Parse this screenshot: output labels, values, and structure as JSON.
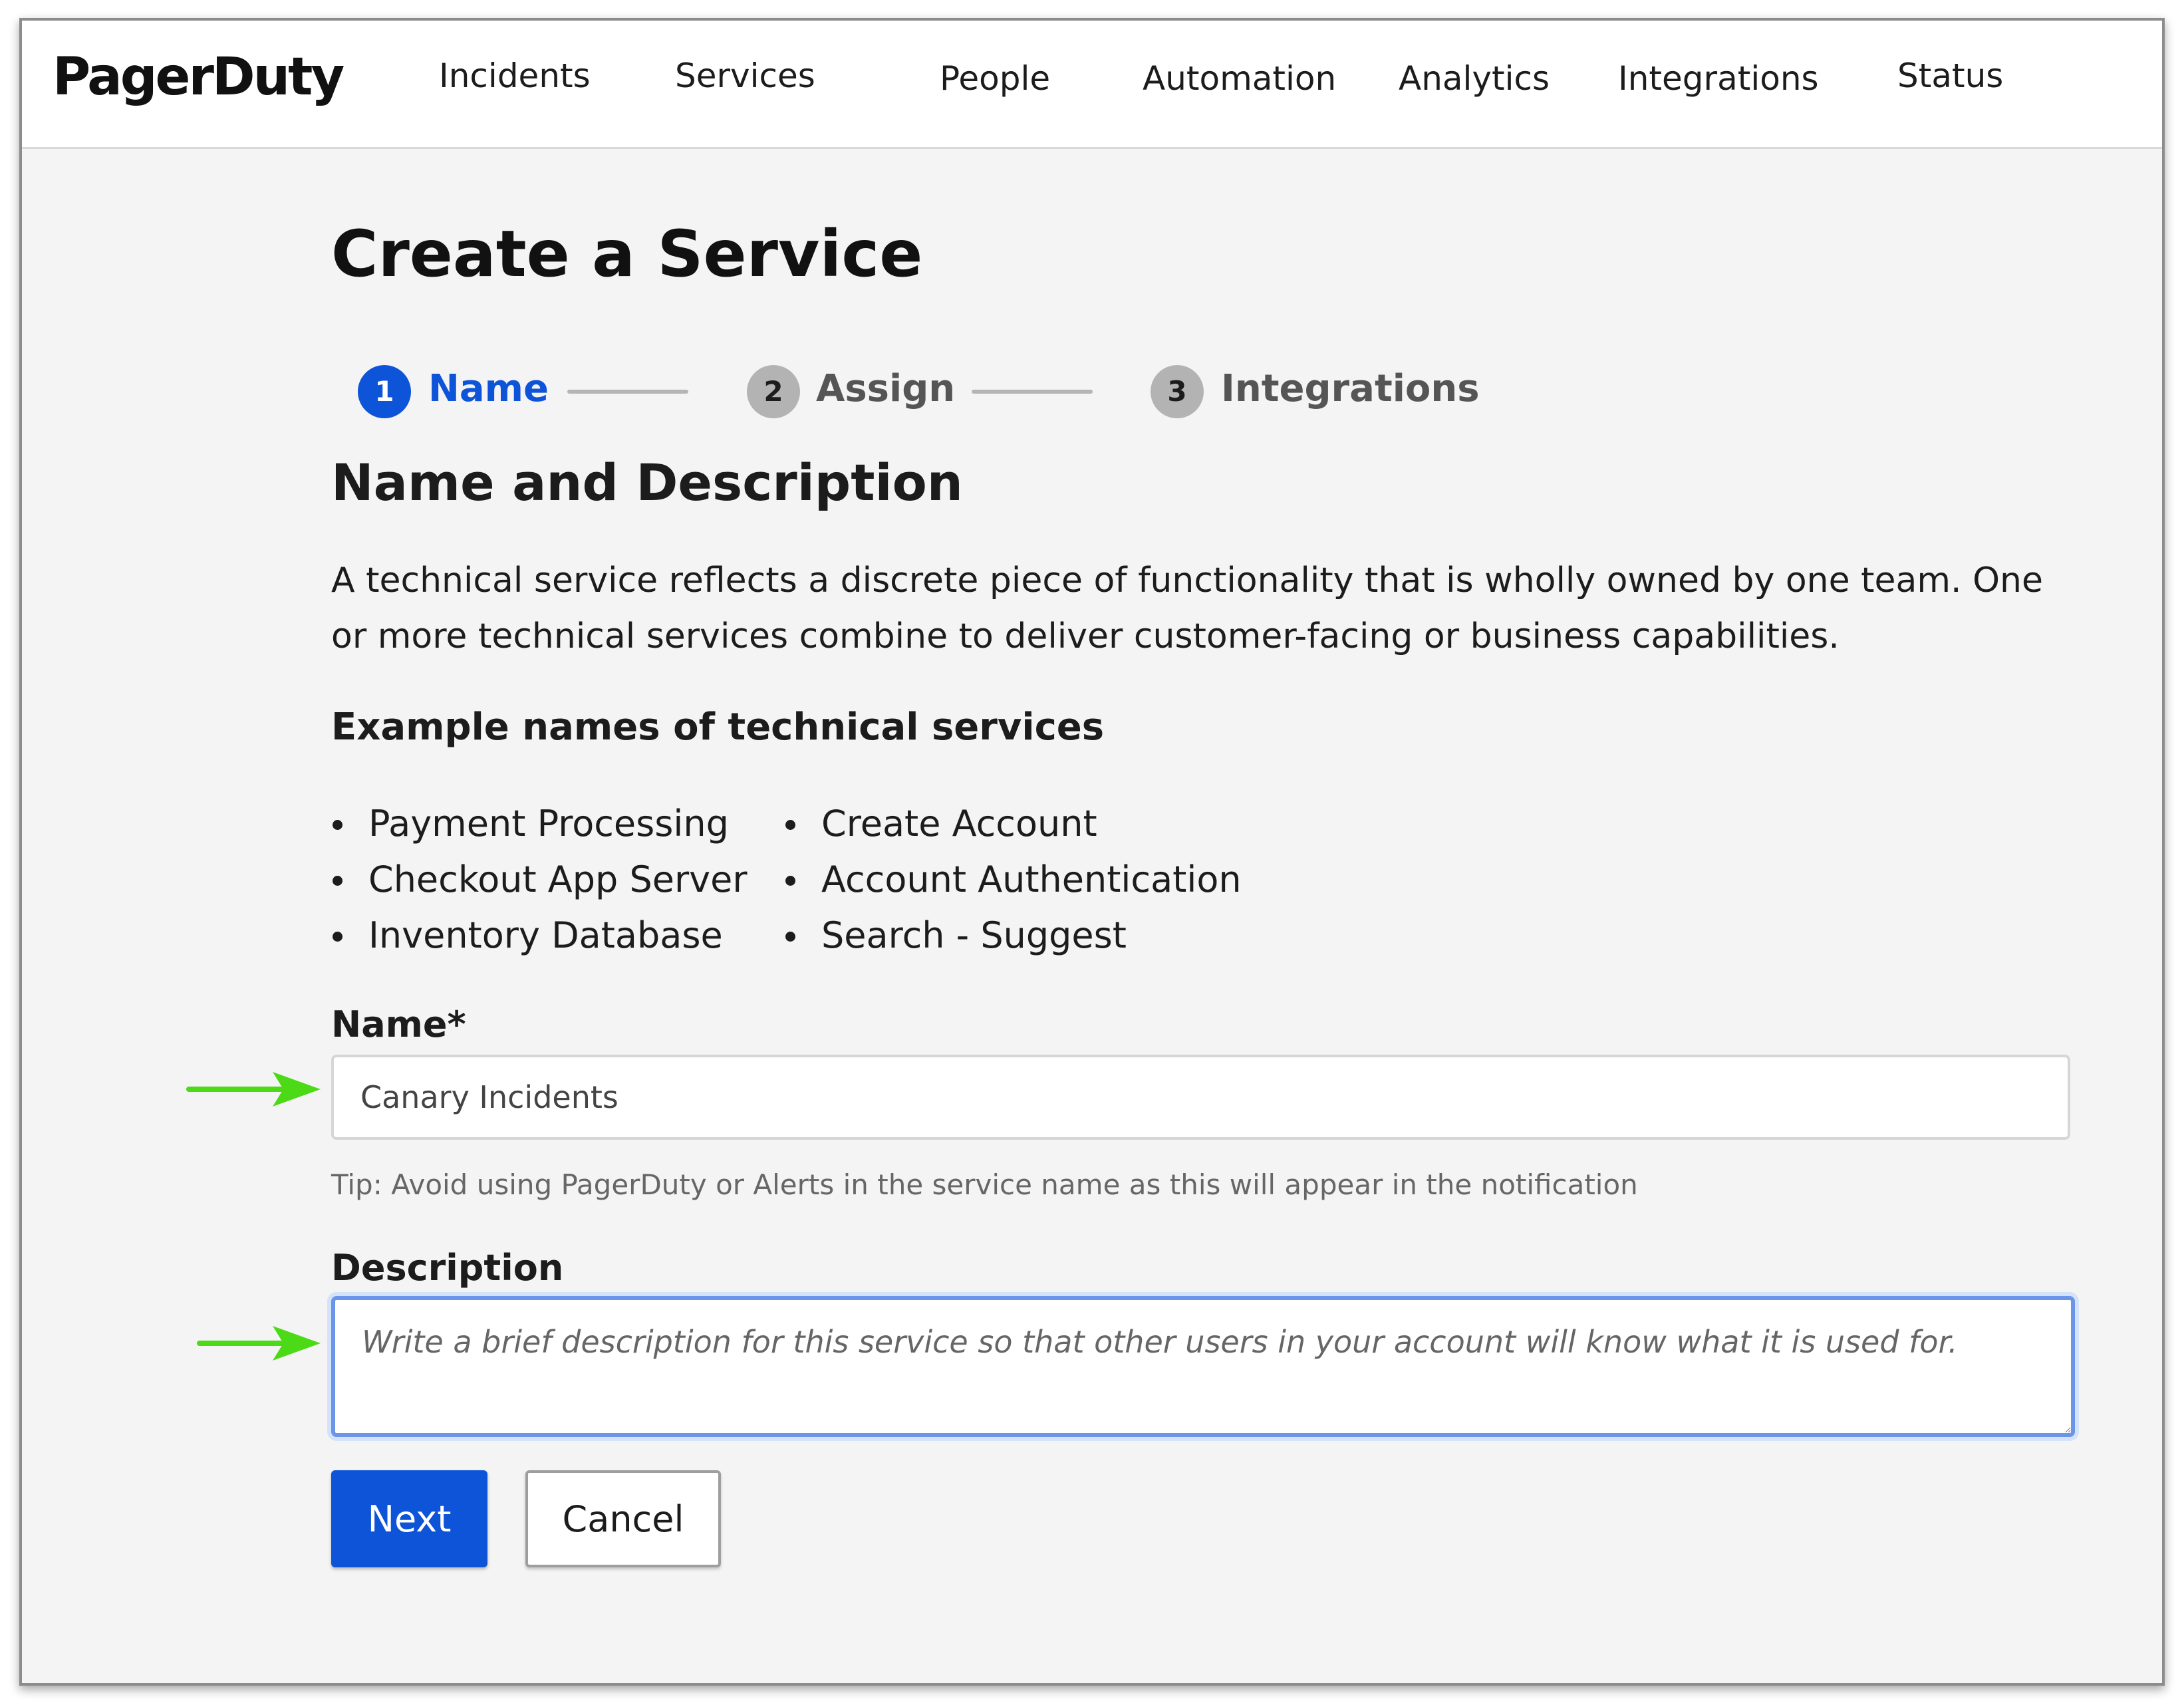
{
  "brand": {
    "logo_text": "PagerDuty"
  },
  "nav": {
    "items": [
      {
        "label": "Incidents"
      },
      {
        "label": "Services"
      },
      {
        "label": "People"
      },
      {
        "label": "Automation"
      },
      {
        "label": "Analytics"
      },
      {
        "label": "Integrations"
      },
      {
        "label": "Status"
      }
    ]
  },
  "page": {
    "title": "Create a Service"
  },
  "stepper": {
    "steps": [
      {
        "number": "1",
        "label": "Name",
        "state": "active"
      },
      {
        "number": "2",
        "label": "Assign",
        "state": "inactive"
      },
      {
        "number": "3",
        "label": "Integrations",
        "state": "inactive"
      }
    ]
  },
  "section": {
    "title": "Name and Description",
    "description": "A technical service reflects a discrete piece of functionality that is wholly owned by one team. One or more technical services combine to deliver customer-facing or business capabilities.",
    "examples_title": "Example names of technical services",
    "examples_col1": [
      "Payment Processing",
      "Checkout App Server",
      "Inventory Database"
    ],
    "examples_col2": [
      "Create Account",
      "Account Authentication",
      "Search - Suggest"
    ]
  },
  "form": {
    "name_label": "Name*",
    "name_value": "Canary Incidents",
    "tip": "Tip: Avoid using PagerDuty or Alerts in the service name as this will appear in the notification",
    "description_label": "Description",
    "description_placeholder": "Write a brief description for this service so that other users in your account will know what it is used for.",
    "description_value": ""
  },
  "actions": {
    "next_label": "Next",
    "cancel_label": "Cancel"
  },
  "colors": {
    "primary": "#0d54d8",
    "annotation_arrow": "#4cd916",
    "focus_ring": "#6b95e8",
    "step_inactive": "#b3b3b3"
  }
}
